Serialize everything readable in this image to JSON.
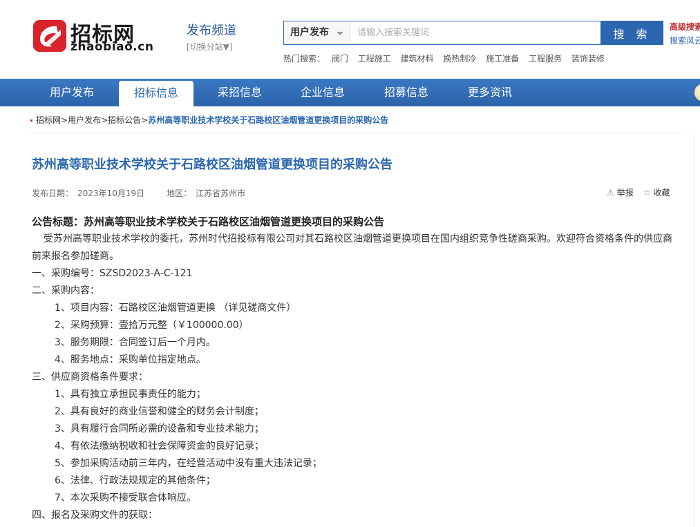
{
  "logo": {
    "cn": "招标网",
    "en": "zhaobiao.cn"
  },
  "channel": {
    "title": "发布频道",
    "switch": "[切换分站▼]"
  },
  "search": {
    "select_value": "用户发布",
    "placeholder": "请输入搜索关键词",
    "button": "搜 索",
    "advanced": "高级搜索",
    "wind": "搜索风云"
  },
  "hot": {
    "label": "热门搜索：",
    "items": [
      "阀门",
      "工程施工",
      "建筑材料",
      "换热制冷",
      "施工准备",
      "工程服务",
      "装饰装修"
    ]
  },
  "nav": {
    "items": [
      "用户发布",
      "招标信息",
      "采招信息",
      "企业信息",
      "招募信息",
      "更多资讯"
    ],
    "active": "招标信息"
  },
  "breadcrumb": {
    "items": [
      "招标网",
      "用户发布",
      "招标公告"
    ],
    "current": "苏州高等职业技术学校关于石路校区油烟管道更换项目的采购公告",
    "sep": ">"
  },
  "article": {
    "title": "苏州高等职业技术学校关于石路校区油烟管道更换项目的采购公告",
    "meta": {
      "date_label": "发布日期：",
      "date": "2023年10月19日",
      "region_label": "地区：",
      "region": "江苏省苏州市"
    },
    "tools": {
      "report": "举报",
      "favorite": "收藏"
    },
    "lead": "公告标题：苏州高等职业技术学校关于石路校区油烟管道更换项目的采购公告",
    "intro": "受苏州高等职业技术学校的委托，苏州时代招投标有限公司对其石路校区油烟管道更换项目在国内组织竞争性磋商采购。欢迎符合资格条件的供应商前来报名参加磋商。",
    "s1": "一、采购编号：SZSD2023-A-C-121",
    "s2": "二、采购内容：",
    "s2_items": [
      "1、项目内容：石路校区油烟管道更换 （详见磋商文件）",
      "2、采购预算：壹拾万元整（￥100000.00）",
      "3、服务期限：合同签订后一个月内。",
      "4、服务地点：采购单位指定地点。"
    ],
    "s3": "三、供应商资格条件要求：",
    "s3_items": [
      "1、具有独立承担民事责任的能力；",
      "2、具有良好的商业信誉和健全的财务会计制度；",
      "3、具有履行合同所必需的设备和专业技术能力；",
      "4、有依法缴纳税收和社会保障资金的良好记录；",
      "5、参加采购活动前三年内，在经营活动中没有重大违法记录；",
      "6、法律、行政法规规定的其他条件；",
      "7、本次采购不接受联合体响应。"
    ],
    "s4": "四、报名及采购文件的获取："
  }
}
